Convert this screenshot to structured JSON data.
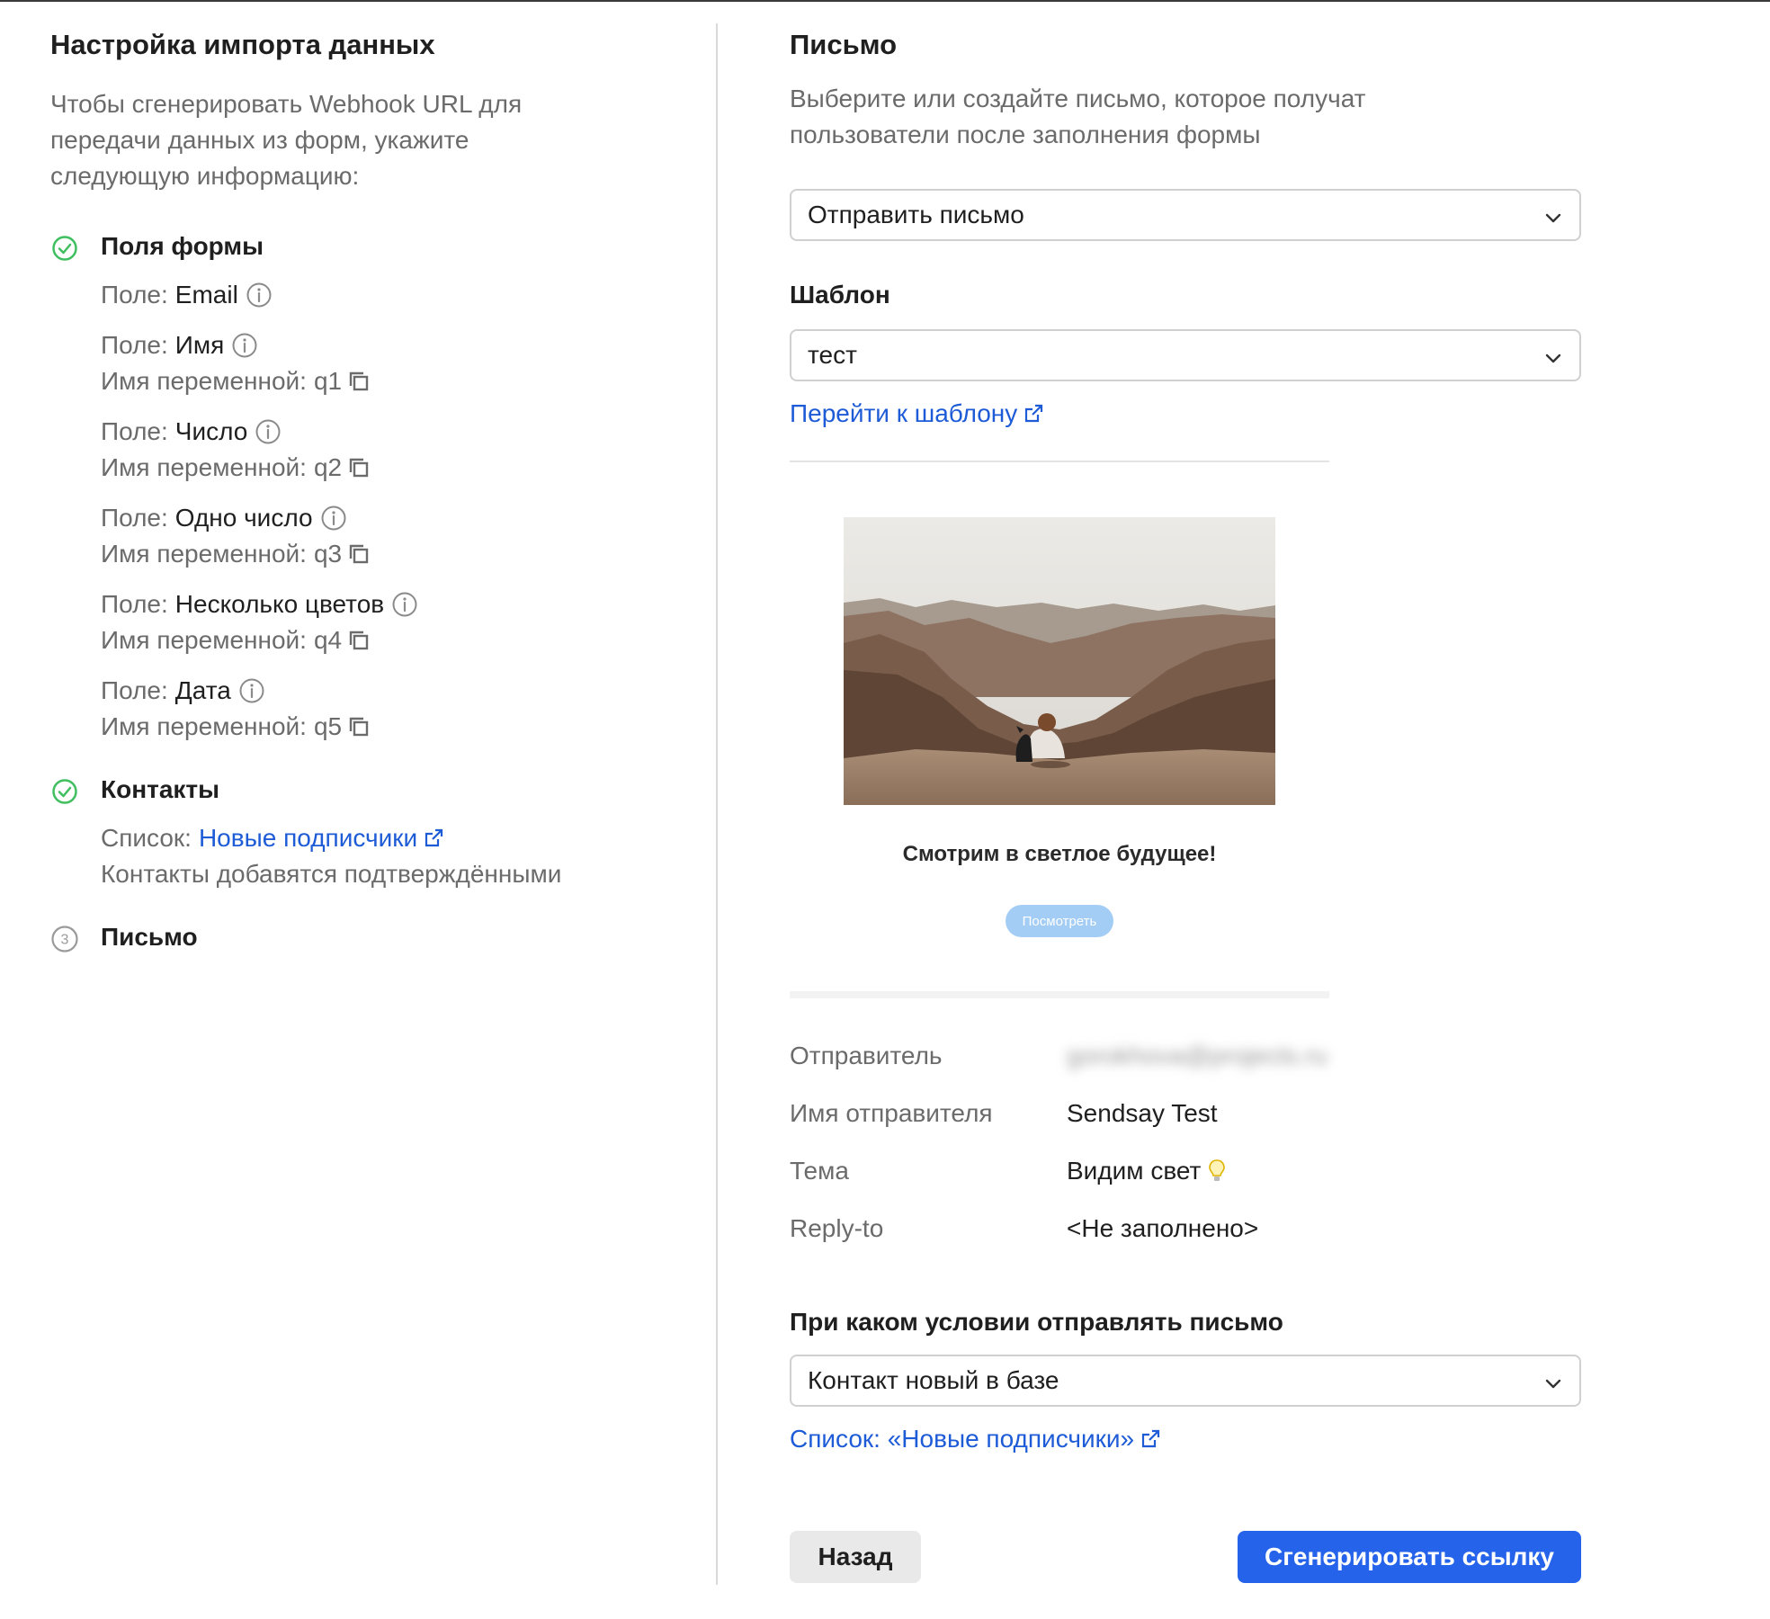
{
  "left": {
    "title": "Настройка импорта данных",
    "description": "Чтобы сгенерировать Webhook URL для передачи данных из форм, укажите следующую информацию:",
    "step1": {
      "title": "Поля формы",
      "field_prefix": "Поле:",
      "var_prefix": "Имя переменной:",
      "fields": [
        {
          "name": "Email"
        },
        {
          "name": "Имя",
          "var": "q1"
        },
        {
          "name": "Число",
          "var": "q2"
        },
        {
          "name": "Одно число",
          "var": "q3"
        },
        {
          "name": "Несколько цветов",
          "var": "q4"
        },
        {
          "name": "Дата",
          "var": "q5"
        }
      ]
    },
    "step2": {
      "title": "Контакты",
      "list_prefix": "Список:",
      "list_link": "Новые подписчики",
      "note": "Контакты добавятся подтверждёнными"
    },
    "step3": {
      "number": "3",
      "title": "Письмо"
    }
  },
  "right": {
    "title": "Письмо",
    "description": "Выберите или создайте письмо, которое получат пользователи после заполнения формы",
    "send_select": "Отправить письмо",
    "template_label": "Шаблон",
    "template_select": "тест",
    "template_link": "Перейти к шаблону",
    "preview": {
      "heading": "Смотрим в светлое будущее!",
      "button": "Посмотреть"
    },
    "details": [
      {
        "key": "Отправитель",
        "value": "gorokhova@projects.ru",
        "blurred": true
      },
      {
        "key": "Имя отправителя",
        "value": "Sendsay Test"
      },
      {
        "key": "Тема",
        "value": "Видим свет"
      },
      {
        "key": "Reply-to",
        "value": "<Не заполнено>"
      }
    ],
    "condition_label": "При каком условии отправлять письмо",
    "condition_select": "Контакт новый в базе",
    "condition_link": "Список: «Новые подписчики»",
    "back_button": "Назад",
    "generate_button": "Сгенерировать ссылку"
  },
  "colors": {
    "accent": "#2563eb",
    "link": "#1e5bd6",
    "success": "#3fbf5f"
  }
}
